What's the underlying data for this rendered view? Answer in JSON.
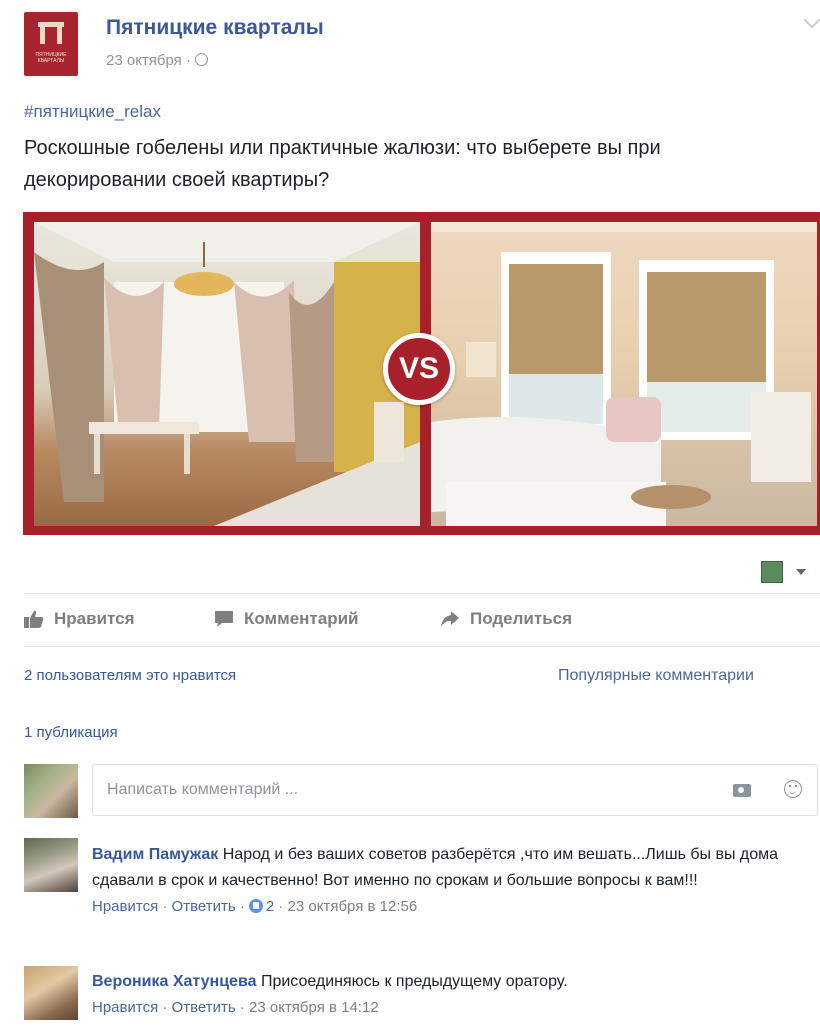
{
  "post": {
    "page_name": "Пятницкие кварталы",
    "avatar_text": "ПЯТНИЦКИЕ КВАРТАЛЫ",
    "date": "23 октября ·",
    "hashtag": "#пятницкие_relax",
    "text": "Роскошные гобелены или практичные жалюзи: что выберете вы при декорировании своей квартиры?",
    "image_badge": "VS"
  },
  "actions": {
    "like": "Нравится",
    "comment": "Комментарий",
    "share": "Поделиться"
  },
  "reactions": {
    "likes_text": "2 пользователям это нравится",
    "sort_label": "Популярные комментарии",
    "shares_text": "1 публикация"
  },
  "composer": {
    "placeholder": "Написать комментарий ..."
  },
  "comments": [
    {
      "author": "Вадим Памужак",
      "text": "Народ и без ваших советов разберётся ,что им вешать...Лишь бы вы дома сдавали в срок и качественно! Вот именно по срокам и большие вопросы к вам!!!",
      "like_label": "Нравится",
      "reply_label": "Ответить",
      "likes": "2",
      "time": "23 октября в 12:56"
    },
    {
      "author": "Вероника Хатунцева",
      "text": "Присоединяюсь к предыдущему оратору.",
      "like_label": "Нравится",
      "reply_label": "Ответить",
      "time": "23 октября в 14:12"
    }
  ],
  "colors": {
    "brand_red": "#a8212a",
    "link_blue": "#365899",
    "action_gray": "#7f7f7f"
  }
}
